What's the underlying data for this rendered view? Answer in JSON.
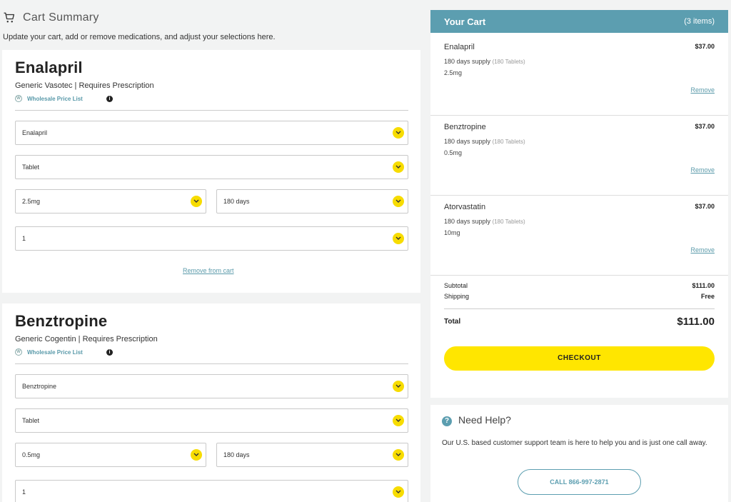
{
  "header": {
    "title": "Cart Summary",
    "subtitle": "Update your cart, add or remove medications, and adjust your selections here."
  },
  "medications": [
    {
      "name": "Enalapril",
      "generic": "Generic Vasotec | Requires Prescription",
      "price_list_link": "Wholesale Price List",
      "drug_select": "Enalapril",
      "form_select": "Tablet",
      "strength_select": "2.5mg",
      "supply_select": "180 days",
      "quantity_select": "1",
      "remove_label": "Remove from cart"
    },
    {
      "name": "Benztropine",
      "generic": "Generic Cogentin | Requires Prescription",
      "price_list_link": "Wholesale Price List",
      "drug_select": "Benztropine",
      "form_select": "Tablet",
      "strength_select": "0.5mg",
      "supply_select": "180 days",
      "quantity_select": "1"
    }
  ],
  "your_cart": {
    "title": "Your Cart",
    "count": "(3 items)",
    "items": [
      {
        "name": "Enalapril",
        "price": "$37.00",
        "supply": "180 days supply",
        "tablets": "(180 Tablets)",
        "dose": "2.5mg",
        "remove": "Remove"
      },
      {
        "name": "Benztropine",
        "price": "$37.00",
        "supply": "180 days supply",
        "tablets": "(180 Tablets)",
        "dose": "0.5mg",
        "remove": "Remove"
      },
      {
        "name": "Atorvastatin",
        "price": "$37.00",
        "supply": "180 days supply",
        "tablets": "(180 Tablets)",
        "dose": "10mg",
        "remove": "Remove"
      }
    ],
    "subtotal_label": "Subtotal",
    "subtotal_value": "$111.00",
    "shipping_label": "Shipping",
    "shipping_value": "Free",
    "total_label": "Total",
    "total_value": "$111.00",
    "checkout_label": "CHECKOUT"
  },
  "help": {
    "title": "Need Help?",
    "description": "Our U.S. based customer support team is here to help you and is just one call away.",
    "call_label": "CALL 866-997-2871"
  },
  "colors": {
    "accent_teal": "#5c9eb0",
    "accent_yellow": "#ffe600",
    "background": "#f2f3f3"
  },
  "icons": {
    "cart": "cart-icon",
    "chevron": "chevron-down-icon",
    "info": "info-icon",
    "help": "question-icon",
    "wordpress": "wordpress-icon"
  }
}
